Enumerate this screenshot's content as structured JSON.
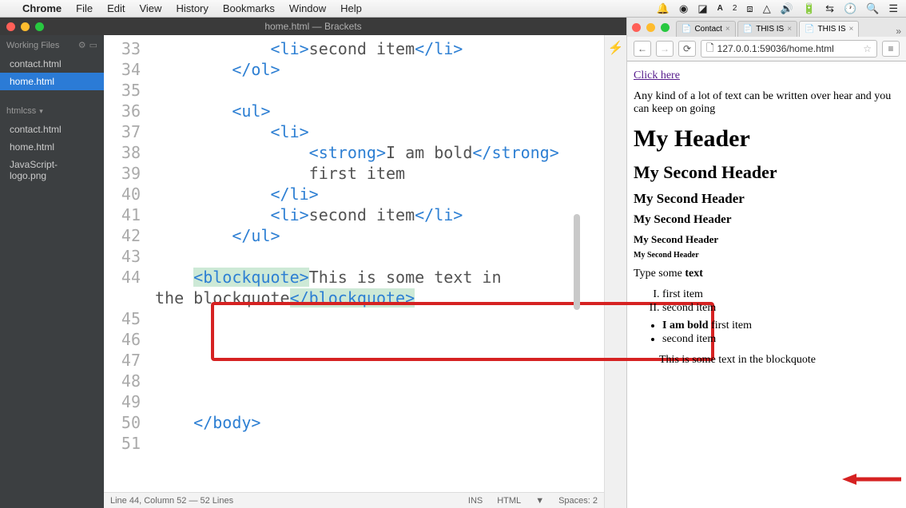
{
  "menubar": {
    "apple": "",
    "app": "Chrome",
    "items": [
      "File",
      "Edit",
      "View",
      "History",
      "Bookmarks",
      "Window",
      "Help"
    ],
    "right_icons": [
      "notif",
      "circle",
      "box",
      "adobe",
      "num",
      "dropbox",
      "drive",
      "volume",
      "battery",
      "wifi",
      "clock",
      "search",
      "menu"
    ]
  },
  "brackets": {
    "title": "home.html — Brackets",
    "working_files_label": "Working Files",
    "working_files": [
      "contact.html",
      "home.html"
    ],
    "working_active": "home.html",
    "project_label": "htmlcss",
    "project_files": [
      "contact.html",
      "home.html",
      "JavaScript-logo.png"
    ],
    "status_left": "Line 44, Column 52 — 52 Lines",
    "status_right": [
      "INS",
      "HTML",
      "▼",
      "Spaces: 2"
    ],
    "code": [
      {
        "n": "33",
        "ind": "            ",
        "pre": "<li>",
        "text": "second item",
        "post": "</li>"
      },
      {
        "n": "34",
        "ind": "        ",
        "pre": "</ol>",
        "text": "",
        "post": ""
      },
      {
        "n": "35",
        "ind": "",
        "pre": "",
        "text": "",
        "post": ""
      },
      {
        "n": "36",
        "ind": "        ",
        "pre": "<ul>",
        "text": "",
        "post": ""
      },
      {
        "n": "37",
        "ind": "            ",
        "pre": "<li>",
        "text": "",
        "post": ""
      },
      {
        "n": "38",
        "ind": "                ",
        "pre": "<strong>",
        "text": "I am bold",
        "post": "</strong>"
      },
      {
        "n": "39",
        "ind": "                ",
        "pre": "",
        "text": "first item",
        "post": ""
      },
      {
        "n": "40",
        "ind": "            ",
        "pre": "</li>",
        "text": "",
        "post": ""
      },
      {
        "n": "41",
        "ind": "            ",
        "pre": "<li>",
        "text": "second item",
        "post": "</li>"
      },
      {
        "n": "42",
        "ind": "        ",
        "pre": "</ul>",
        "text": "",
        "post": ""
      },
      {
        "n": "43",
        "ind": "",
        "pre": "",
        "text": "",
        "post": ""
      },
      {
        "n": "44",
        "ind": "    ",
        "pre": "<blockquote>",
        "text": "This is some text in",
        "post": "",
        "hlpre": true,
        "wrap": true
      },
      {
        "n": "",
        "ind": "",
        "pre": "",
        "text": "the blockquote",
        "post": "</blockquote>",
        "hlpost": true
      },
      {
        "n": "45",
        "ind": "",
        "pre": "",
        "text": "",
        "post": ""
      },
      {
        "n": "46",
        "ind": "",
        "pre": "",
        "text": "",
        "post": ""
      },
      {
        "n": "47",
        "ind": "",
        "pre": "",
        "text": "",
        "post": ""
      },
      {
        "n": "48",
        "ind": "",
        "pre": "",
        "text": "",
        "post": ""
      },
      {
        "n": "49",
        "ind": "",
        "pre": "",
        "text": "",
        "post": ""
      },
      {
        "n": "50",
        "ind": "    ",
        "pre": "</body>",
        "text": "",
        "post": ""
      },
      {
        "n": "51",
        "ind": "",
        "pre": "",
        "text": "",
        "post": ""
      }
    ]
  },
  "browser": {
    "tabs": [
      {
        "label": "Contact",
        "active": false,
        "icon": "📄"
      },
      {
        "label": "THIS IS",
        "active": false,
        "icon": "📄"
      },
      {
        "label": "THIS IS",
        "active": true,
        "icon": "📄"
      }
    ],
    "url": "127.0.0.1:59036/home.html",
    "page": {
      "link": "Click here",
      "para": "Any kind of a lot of text can be written over hear and you can keep on going",
      "h1": "My Header",
      "h2": "My Second Header",
      "h3": "My Second Header",
      "h4": "My Second Header",
      "h5": "My Second Header",
      "h6": "My Second Header",
      "type_some": "Type some ",
      "type_bold": "text",
      "ol": [
        "first item",
        "second item"
      ],
      "ul_bold": "I am bold",
      "ul_rest": " first item",
      "ul2": "second item",
      "bq": "This is some text in the blockquote"
    }
  }
}
